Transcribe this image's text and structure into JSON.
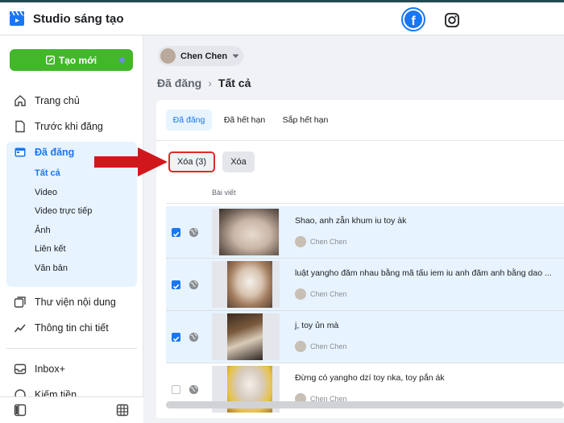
{
  "app": {
    "title": "Studio sáng tạo"
  },
  "social": {
    "facebook_icon": "facebook-icon",
    "instagram_icon": "instagram-icon",
    "facebook_letter": "f"
  },
  "sidebar": {
    "create_button": "Tạo mới",
    "items": [
      {
        "label": "Trang chủ",
        "icon": "home-icon"
      },
      {
        "label": "Trước khi đăng",
        "icon": "document-icon"
      },
      {
        "label": "Đã đăng",
        "icon": "calendar-icon"
      },
      {
        "label": "Thư viện nội dung",
        "icon": "library-icon"
      },
      {
        "label": "Thông tin chi tiết",
        "icon": "insights-icon"
      },
      {
        "label": "Inbox+",
        "icon": "inbox-icon"
      },
      {
        "label": "Kiếm tiền",
        "icon": "money-icon"
      }
    ],
    "sub_items": [
      "Tất cả",
      "Video",
      "Video trực tiếp",
      "Ảnh",
      "Liên kết",
      "Văn bản"
    ]
  },
  "account": {
    "name": "Chen Chen"
  },
  "breadcrumb": {
    "parent": "Đã đăng",
    "separator": "›",
    "current": "Tất cả"
  },
  "tabs": [
    "Đã đăng",
    "Đã hết hạn",
    "Sắp hết hạn"
  ],
  "actions": {
    "delete_selected": "Xóa (3)",
    "delete": "Xóa"
  },
  "table": {
    "column_header": "Bài viết",
    "rows": [
      {
        "title": "Shao, anh zẫn khum iu toy àk",
        "author": "Chen Chen",
        "selected": true
      },
      {
        "title": "luật yangho đăm nhau bằng mã tấu iem iu anh đăm anh bằng dao ...",
        "author": "Chen Chen",
        "selected": true
      },
      {
        "title": "j, toy ủn mà",
        "author": "Chen Chen",
        "selected": true
      },
      {
        "title": "Đừng có yangho dzí toy nka, toy pắn ák",
        "author": "Chen Chen",
        "selected": false
      }
    ]
  },
  "colors": {
    "accent": "#1877f2",
    "create": "#42b72a",
    "highlight_border": "#e0292b",
    "arrow": "#e0292b"
  }
}
